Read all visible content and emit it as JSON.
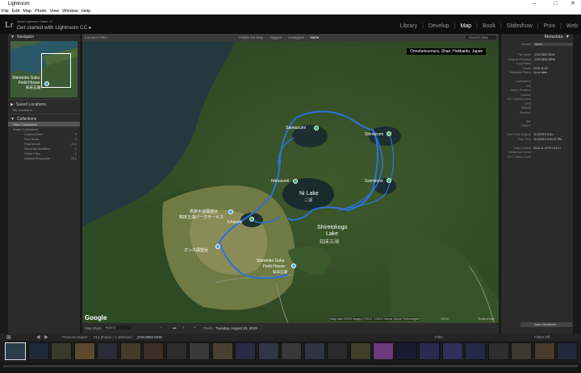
{
  "window": {
    "title": "Lightroom",
    "minimize": "–",
    "maximize": "□",
    "close": "✕"
  },
  "menu": [
    "File",
    "Edit",
    "Map",
    "Photo",
    "View",
    "Window",
    "Help"
  ],
  "identity": {
    "logo": "Lr",
    "small": "Adobe Lightroom Classic CC",
    "big": "Get started with Lightroom CC ▸"
  },
  "modules": [
    "Library",
    "Develop",
    "Map",
    "Book",
    "Slideshow",
    "Print",
    "Web"
  ],
  "navigator": {
    "title": "Navigator",
    "place1": "Shiretoko Goko",
    "place2": "Field House",
    "place3": "知床五湖"
  },
  "saved_locations": {
    "title": "Saved Locations",
    "item": "My Locations"
  },
  "collections": {
    "title": "Collections",
    "filter": "Filter Collections",
    "smart": "Smart Collections",
    "items": [
      {
        "label": "Colored Red",
        "count": "0"
      },
      {
        "label": "Five Stars",
        "count": "0"
      },
      {
        "label": "Past Month",
        "count": "212"
      },
      {
        "label": "Recently Modified",
        "count": "1"
      },
      {
        "label": "Video Files",
        "count": "1"
      },
      {
        "label": "Without Keywords",
        "count": "212"
      }
    ]
  },
  "mapbar": {
    "title": "Location Filter :",
    "opts": [
      "Visible On Map",
      "Tagged",
      "Untagged",
      "None"
    ],
    "search": "Search Map"
  },
  "map": {
    "location": "Onnebetsumura, Shari, Hokkaido, Japan",
    "lake_main": "Ni Lake",
    "lake_main_jp": "二湖",
    "lake_big1": "Shiretokogo",
    "lake_big2": "Lake",
    "lake_big3": "知床五湖",
    "pins": [
      "Sannuzumi",
      "Shimizumi",
      "Nimuzumi",
      "Gomizumi",
      "Ichizumi"
    ],
    "jp1": "高架木道展望台",
    "jp2": "知床五湖パークサービス",
    "jp3": "オンネ展望台",
    "fh1": "Shiretoko Goko",
    "fh2": "Field House",
    "fh3": "知床五湖",
    "google": "Google",
    "attr": "Map data ©2019 Imagery ©2019 , CNES / Airbus, Maxar Technologies",
    "scale": "100 m",
    "terms": "Terms of Use"
  },
  "mapfoot": {
    "style_label": "Map Style :",
    "style": "Hybrid",
    "track": "Track :",
    "date": "Tuesday, August 20, 2019"
  },
  "metadata": {
    "title": "Metadata",
    "preset_label": "Default",
    "preset": "None",
    "rows": [
      [
        "File Name",
        "_DSC3502.DNG"
      ],
      [
        "Original Filename",
        "_DSC3502.ARW"
      ],
      [
        "Copy Name",
        ""
      ],
      [
        "Folder",
        "2019-11-02"
      ],
      [
        "Metadata Status",
        "Up to date"
      ],
      [
        "",
        ""
      ],
      [
        "Sublocation",
        ""
      ],
      [
        "City",
        ""
      ],
      [
        "State / Province",
        ""
      ],
      [
        "Country",
        ""
      ],
      [
        "ISO Country Code",
        ""
      ],
      [
        "GPS",
        ""
      ],
      [
        "Altitude",
        ""
      ],
      [
        "Direction",
        ""
      ],
      [
        "",
        ""
      ],
      [
        "Title",
        ""
      ],
      [
        "Caption",
        ""
      ],
      [
        "",
        ""
      ],
      [
        "Date Time Original",
        "11/2/2019 9:54:.."
      ],
      [
        "Date Time",
        "11/2/2019 9:54:37 PM"
      ],
      [
        "",
        ""
      ],
      [
        "Date Created",
        "2019-11-02T21:54:37"
      ],
      [
        "Intellectual Genre",
        ""
      ],
      [
        "IPTC Scene Code",
        ""
      ]
    ],
    "save": "Save Metadata..."
  },
  "filmbar": {
    "prev": "Previous Import",
    "count": "212 photos / 1 selected /",
    "file": "_DSC3502.DNG",
    "filter": "Filter :",
    "filters_off": "Filters Off"
  }
}
